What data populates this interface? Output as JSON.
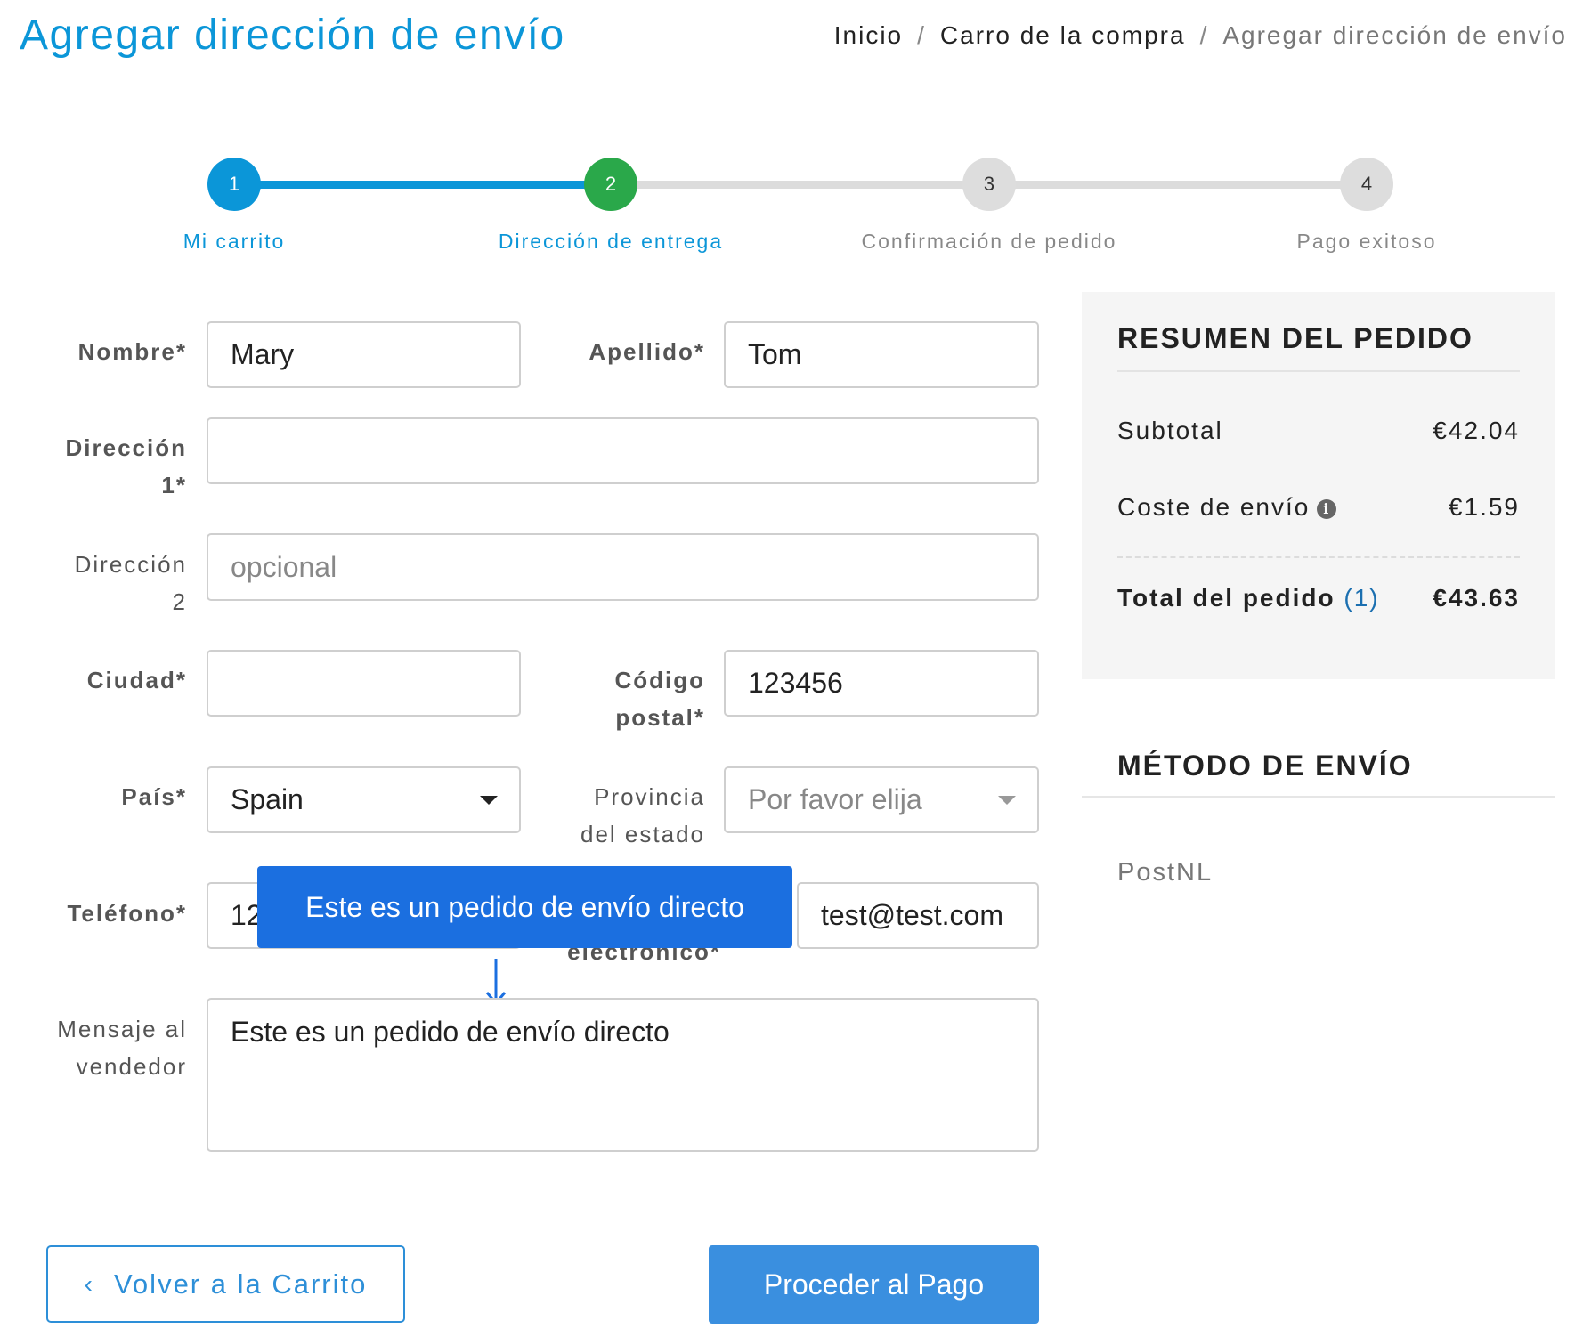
{
  "header": {
    "title": "Agregar dirección de envío",
    "breadcrumb": [
      "Inicio",
      "Carro de la compra",
      "Agregar dirección de envío"
    ]
  },
  "stepper": {
    "steps": [
      {
        "number": "1",
        "label": "Mi carrito",
        "state": "done",
        "color": "#0b96d8"
      },
      {
        "number": "2",
        "label": "Dirección de entrega",
        "state": "current",
        "color": "#2aa84a"
      },
      {
        "number": "3",
        "label": "Confirmación de pedido",
        "state": "pending",
        "color": "#dddddd"
      },
      {
        "number": "4",
        "label": "Pago exitoso",
        "state": "pending",
        "color": "#dddddd"
      }
    ]
  },
  "form": {
    "first_name": {
      "label": "Nombre*",
      "value": "Mary"
    },
    "last_name": {
      "label": "Apellido*",
      "value": "Tom"
    },
    "address1": {
      "label_line1": "Dirección",
      "label_line2": "1*",
      "value": ""
    },
    "address2": {
      "label_line1": "Dirección",
      "label_line2": "2",
      "placeholder": "opcional"
    },
    "city": {
      "label": "Ciudad*",
      "value": ""
    },
    "postal": {
      "label_line1": "Código",
      "label_line2": "postal*",
      "value": "123456"
    },
    "country": {
      "label": "País*",
      "selected": "Spain"
    },
    "state": {
      "label_line1": "Provincia",
      "label_line2": "del estado",
      "placeholder": "Por favor elija"
    },
    "phone": {
      "label": "Teléfono*",
      "value_visible": "12"
    },
    "email": {
      "label_visible": "electrónico*",
      "value": "test@test.com"
    },
    "message": {
      "label_line1": "Mensaje al",
      "label_line2": "vendedor",
      "value": "Este es un pedido de envío directo"
    }
  },
  "tooltip": {
    "text": "Este es un pedido de envío directo",
    "color": "#1b6fe0"
  },
  "summary": {
    "title": "RESUMEN DEL PEDIDO",
    "subtotal_label": "Subtotal",
    "subtotal_value": "€42.04",
    "shipping_label": "Coste de envío",
    "shipping_value": "€1.59",
    "total_label": "Total del pedido",
    "total_count": "(1)",
    "total_value": "€43.63"
  },
  "shipping_method": {
    "title": "MÉTODO DE ENVÍO",
    "option": "PostNL"
  },
  "buttons": {
    "back_label": "Volver a la Carrito",
    "back_chevron": "‹",
    "pay_label": "Proceder al Pago"
  },
  "colors": {
    "accent": "#0b96d8",
    "success": "#2aa84a",
    "button": "#3a8fdf"
  }
}
